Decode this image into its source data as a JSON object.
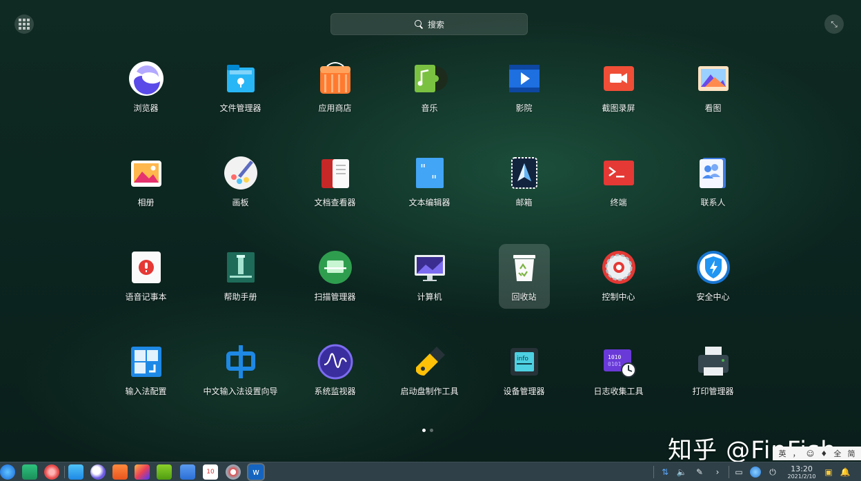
{
  "search": {
    "label": "搜索"
  },
  "apps": [
    {
      "label": "浏览器",
      "icon": "browser-icon"
    },
    {
      "label": "文件管理器",
      "icon": "file-manager-icon"
    },
    {
      "label": "应用商店",
      "icon": "app-store-icon"
    },
    {
      "label": "音乐",
      "icon": "music-icon"
    },
    {
      "label": "影院",
      "icon": "movie-icon"
    },
    {
      "label": "截图录屏",
      "icon": "screenshot-icon"
    },
    {
      "label": "看图",
      "icon": "image-viewer-icon"
    },
    {
      "label": "相册",
      "icon": "album-icon"
    },
    {
      "label": "画板",
      "icon": "drawing-board-icon"
    },
    {
      "label": "文档查看器",
      "icon": "document-viewer-icon"
    },
    {
      "label": "文本编辑器",
      "icon": "text-editor-icon"
    },
    {
      "label": "邮箱",
      "icon": "mail-icon"
    },
    {
      "label": "终端",
      "icon": "terminal-icon"
    },
    {
      "label": "联系人",
      "icon": "contacts-icon"
    },
    {
      "label": "语音记事本",
      "icon": "voice-notes-icon"
    },
    {
      "label": "帮助手册",
      "icon": "help-manual-icon"
    },
    {
      "label": "扫描管理器",
      "icon": "scanner-icon"
    },
    {
      "label": "计算机",
      "icon": "computer-icon"
    },
    {
      "label": "回收站",
      "icon": "trash-icon",
      "selected": true
    },
    {
      "label": "控制中心",
      "icon": "control-center-icon"
    },
    {
      "label": "安全中心",
      "icon": "security-center-icon"
    },
    {
      "label": "输入法配置",
      "icon": "input-method-config-icon"
    },
    {
      "label": "中文输入法设置向导",
      "icon": "chinese-ime-wizard-icon"
    },
    {
      "label": "系统监视器",
      "icon": "system-monitor-icon"
    },
    {
      "label": "启动盘制作工具",
      "icon": "boot-maker-icon"
    },
    {
      "label": "设备管理器",
      "icon": "device-manager-icon"
    },
    {
      "label": "日志收集工具",
      "icon": "log-collector-icon"
    },
    {
      "label": "打印管理器",
      "icon": "print-manager-icon"
    }
  ],
  "watermark": "知乎 @FinFish",
  "taskbar": {
    "clock_time": "13:20",
    "clock_date": "2021/2/10",
    "ime": [
      "英",
      "，",
      "☺",
      "♦",
      "全",
      "简"
    ]
  },
  "colors": {
    "accent": "#2a7bd8",
    "taskbar": "#2f4048"
  }
}
